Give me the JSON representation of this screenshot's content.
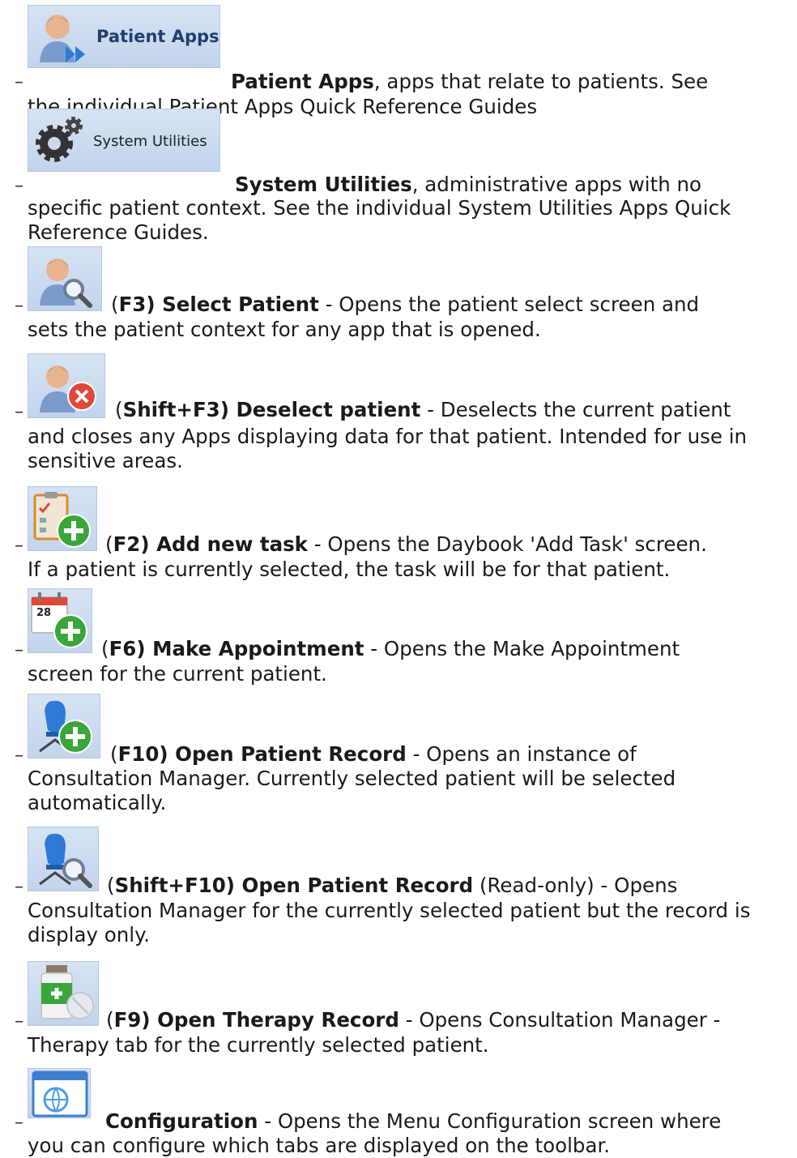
{
  "items": [
    {
      "icon": "patient-apps-button-icon",
      "button_label": "Patient Apps",
      "open": "",
      "title": "Patient Apps",
      "line1_rest": ", apps that relate to patients. See",
      "rest": "the individual Patient Apps Quick Reference Guides"
    },
    {
      "icon": "system-utilities-button-icon",
      "button_label": "System Utilities",
      "open": "",
      "title": "System Utilities",
      "line1_rest": ", administrative apps with no",
      "rest": "specific patient context. See the individual System Utilities Apps Quick Reference Guides."
    },
    {
      "icon": "select-patient-icon",
      "open": "(",
      "title": "F3) Select Patient",
      "line1_rest": " - Opens the patient select screen and",
      "rest": "sets the patient context for any app that is opened."
    },
    {
      "icon": "deselect-patient-icon",
      "open": "(",
      "title": "Shift+F3) Deselect patient",
      "line1_rest": " - Deselects the current patient",
      "rest": "and closes any Apps displaying data for that patient. Intended for use in sensitive areas."
    },
    {
      "icon": "add-task-icon",
      "open": "(",
      "title": "F2) Add new task",
      "line1_rest": " - Opens the Daybook 'Add Task' screen.",
      "rest": "If a patient is currently selected, the task will be for that patient."
    },
    {
      "icon": "make-appointment-icon",
      "calendar_number": "28",
      "open": "(",
      "title": "F6) Make Appointment",
      "line1_rest": " - Opens the Make Appointment",
      "rest": "screen for the current patient."
    },
    {
      "icon": "open-patient-record-icon",
      "open": "(",
      "title": "F10) Open Patient Record",
      "line1_rest": " - Opens an instance of",
      "rest": "Consultation Manager. Currently selected patient will be selected automatically."
    },
    {
      "icon": "open-patient-record-readonly-icon",
      "open": "(",
      "title": "Shift+F10) Open Patient Record",
      "line1_rest": " (Read-only) - Opens",
      "rest": "Consultation Manager for the currently selected patient but the record is display only."
    },
    {
      "icon": "open-therapy-record-icon",
      "open": "(",
      "title": "F9) Open Therapy Record",
      "line1_rest": " - Opens Consultation Manager -",
      "rest": "Therapy tab for the currently selected patient."
    },
    {
      "icon": "configuration-icon",
      "open": "",
      "title": "Configuration",
      "line1_rest": " - Opens the Menu Configuration screen where",
      "rest": "you can configure which tabs are displayed on the toolbar."
    }
  ],
  "dash": "–",
  "colors": {
    "icon_bg": "#c9d9ee",
    "plus_green": "#3aa63a",
    "remove_red": "#e0483a",
    "text": "#1a1a1a"
  }
}
